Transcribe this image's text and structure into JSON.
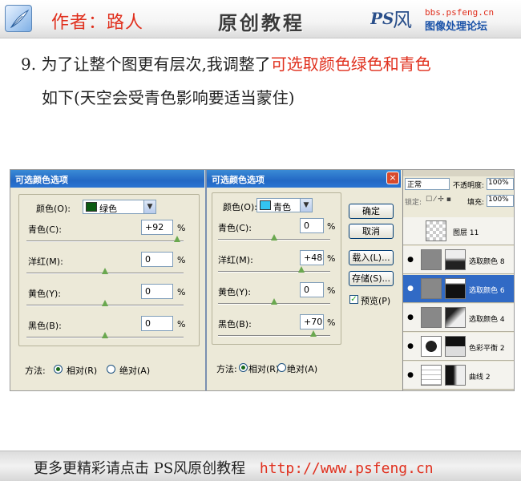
{
  "header": {
    "author": "作者：路人",
    "title": "原创教程",
    "site_url": "bbs.psfeng.cn",
    "site_name": "图像处理论坛"
  },
  "step": {
    "number": "9.",
    "text_a": "为了让整个图更有层次,我调整了",
    "text_highlight": "可选取颜色绿色和青色",
    "text_b": "如下(天空会受青色影响要适当蒙住)"
  },
  "dialog_green": {
    "title": "可选颜色选项",
    "color_label": "颜色(O):",
    "color_value": "绿色",
    "color_hex": "#0c5a12",
    "rows": [
      {
        "label": "青色(C):",
        "value": "+92",
        "level": 92
      },
      {
        "label": "洋红(M):",
        "value": "0",
        "level": 0
      },
      {
        "label": "黄色(Y):",
        "value": "0",
        "level": 0
      },
      {
        "label": "黑色(B):",
        "value": "0",
        "level": 0
      }
    ],
    "percent": "%",
    "method_label": "方法:",
    "relative": "相对(R)",
    "absolute": "绝对(A)"
  },
  "dialog_cyan": {
    "title": "可选颜色选项",
    "color_label": "颜色(O):",
    "color_value": "青色",
    "color_hex": "#33c4f0",
    "rows": [
      {
        "label": "青色(C):",
        "value": "0",
        "level": 0
      },
      {
        "label": "洋红(M):",
        "value": "+48",
        "level": 48
      },
      {
        "label": "黄色(Y):",
        "value": "0",
        "level": 0
      },
      {
        "label": "黑色(B):",
        "value": "+70",
        "level": 70
      }
    ],
    "percent": "%",
    "method_label": "方法:",
    "relative": "相对(R)",
    "absolute": "绝对(A)",
    "buttons": {
      "ok": "确定",
      "cancel": "取消",
      "load": "载入(L)...",
      "save": "存储(S)..."
    },
    "preview": "预览(P)",
    "close": "×"
  },
  "layers_panel": {
    "mode": "正常",
    "opacity_label": "不透明度:",
    "opacity_value": "100%",
    "lock_label": "锁定:",
    "fill_label": "填充:",
    "fill_value": "100%",
    "layers": [
      {
        "name": "图层 11",
        "active": false
      },
      {
        "name": "选取颜色 8",
        "active": false
      },
      {
        "name": "选取颜色 6",
        "active": true
      },
      {
        "name": "选取颜色 4",
        "active": false
      },
      {
        "name": "色彩平衡 2",
        "active": false
      },
      {
        "name": "曲线 2",
        "active": false
      }
    ]
  },
  "footer": {
    "text": "更多更精彩请点击  PS风原创教程",
    "url": "http://www.psfeng.cn"
  }
}
